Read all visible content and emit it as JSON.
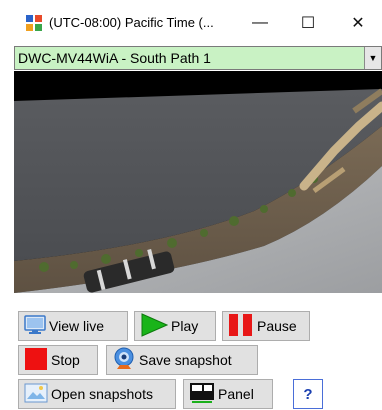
{
  "window": {
    "title": "(UTC-08:00) Pacific Time (...",
    "controls": {
      "minimize": "—",
      "maximize": "☐",
      "close": "✕"
    }
  },
  "camera": {
    "selected": "DWC-MV44WiA - South Path 1",
    "selector_bg": "#c9f2c4"
  },
  "toolbar": {
    "view_live": "View live",
    "play": "Play",
    "pause": "Pause",
    "stop": "Stop",
    "save_snapshot": "Save snapshot",
    "open_snapshots": "Open snapshots",
    "panel": "Panel",
    "help": "?"
  },
  "icons": {
    "view_live": "monitor-icon",
    "play": "play-icon",
    "pause": "pause-icon",
    "stop": "stop-icon",
    "save_snapshot": "webcam-icon",
    "open_snapshots": "image-folder-icon",
    "panel": "panel-icon"
  }
}
